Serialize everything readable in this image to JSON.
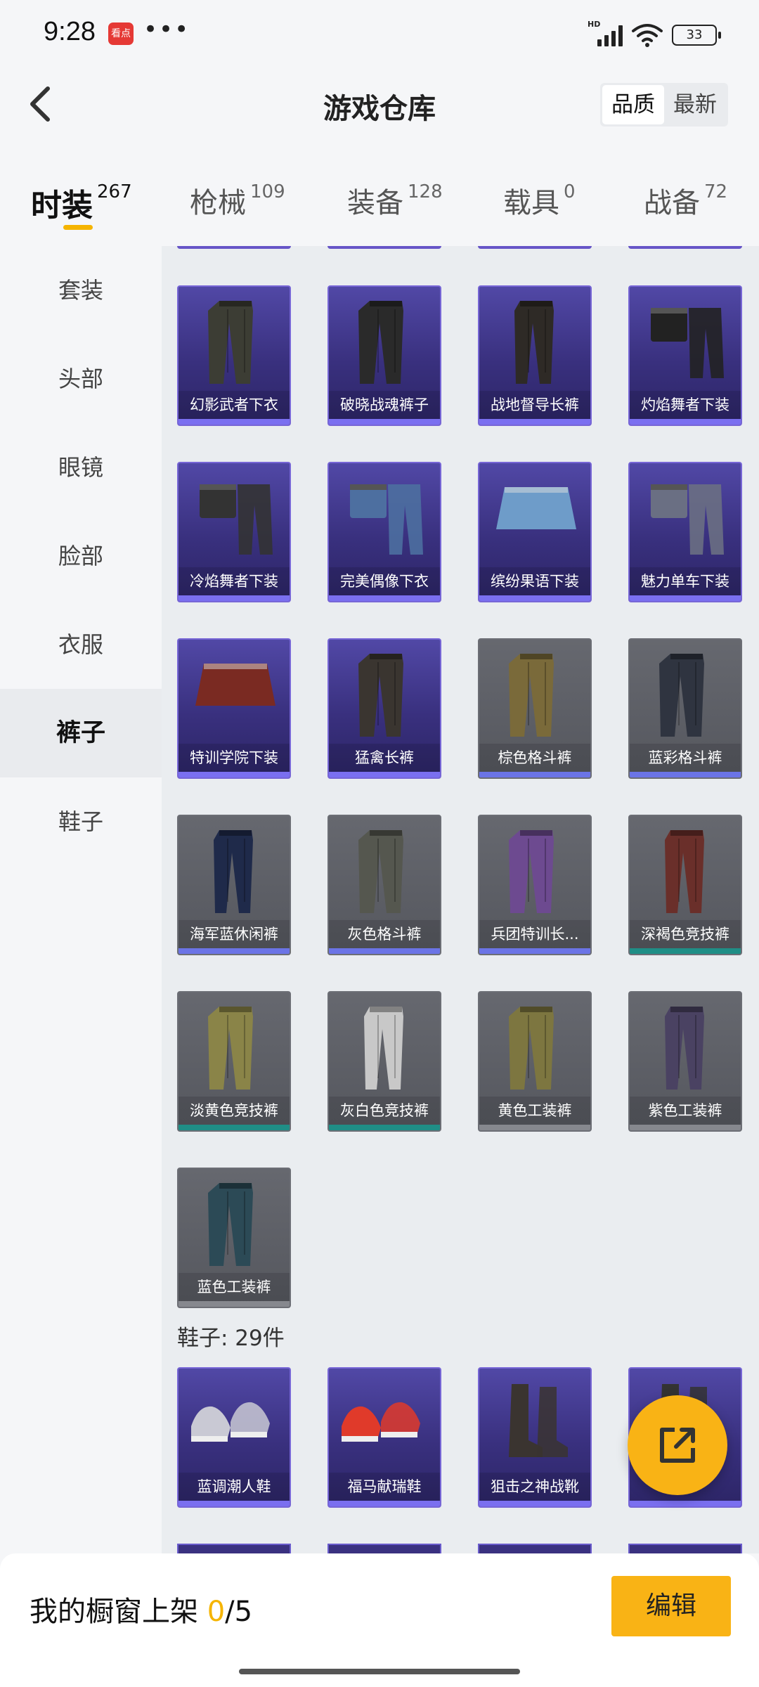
{
  "status": {
    "time": "9:28",
    "app_badge": "看点",
    "dots": "•••",
    "network": "HD",
    "battery": "33"
  },
  "header": {
    "title": "游戏仓库",
    "sort_options": [
      "品质",
      "最新"
    ]
  },
  "categories": [
    {
      "name": "时装",
      "count": "267"
    },
    {
      "name": "枪械",
      "count": "109"
    },
    {
      "name": "装备",
      "count": "128"
    },
    {
      "name": "载具",
      "count": "0"
    },
    {
      "name": "战备",
      "count": "72"
    }
  ],
  "sidebar": [
    "套装",
    "头部",
    "眼镜",
    "脸部",
    "衣服",
    "裤子",
    "鞋子"
  ],
  "pants": [
    {
      "name": "幻影武者下衣"
    },
    {
      "name": "破晓战魂裤子"
    },
    {
      "name": "战地督导长裤"
    },
    {
      "name": "灼焰舞者下装"
    },
    {
      "name": "冷焰舞者下装"
    },
    {
      "name": "完美偶像下衣"
    },
    {
      "name": "缤纷果语下装"
    },
    {
      "name": "魅力单车下装"
    },
    {
      "name": "特训学院下装"
    },
    {
      "name": "猛禽长裤"
    },
    {
      "name": "棕色格斗裤"
    },
    {
      "name": "蓝彩格斗裤"
    },
    {
      "name": "海军蓝休闲裤"
    },
    {
      "name": "灰色格斗裤"
    },
    {
      "name": "兵团特训长..."
    },
    {
      "name": "深褐色竞技裤"
    },
    {
      "name": "淡黄色竞技裤"
    },
    {
      "name": "灰白色竞技裤"
    },
    {
      "name": "黄色工装裤"
    },
    {
      "name": "紫色工装裤"
    },
    {
      "name": "蓝色工装裤"
    }
  ],
  "shoes_section": {
    "title": "鞋子: 29件"
  },
  "shoes": [
    {
      "name": "蓝调潮人鞋"
    },
    {
      "name": "福马献瑞鞋"
    },
    {
      "name": "狙击之神战靴"
    },
    {
      "name": ""
    }
  ],
  "bottom": {
    "shelf_label": "我的橱窗上架 ",
    "shelf_current": "0",
    "shelf_total": "/5",
    "edit_label": "编辑"
  },
  "colors": {
    "accent": "#f9b315",
    "purple_card": "#3c3285",
    "grey_card": "#5e6067"
  }
}
